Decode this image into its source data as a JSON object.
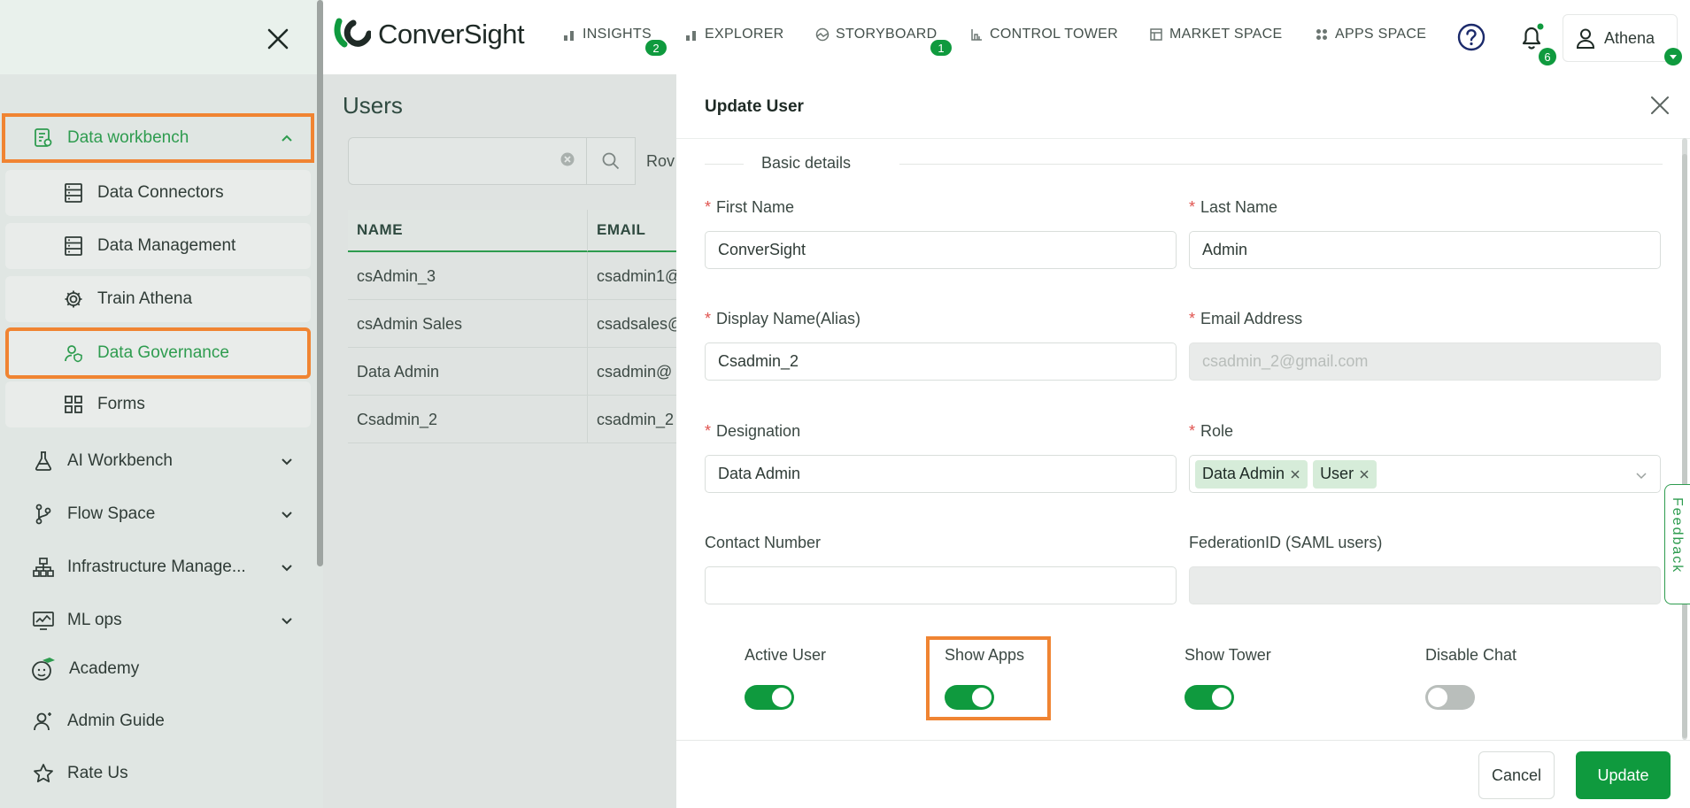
{
  "sidebar": {
    "items": [
      {
        "label": "Data workbench",
        "icon": "data-workbench-icon"
      },
      {
        "label": "Data Connectors",
        "icon": "database-icon"
      },
      {
        "label": "Data Management",
        "icon": "database-icon"
      },
      {
        "label": "Train Athena",
        "icon": "gear-icon"
      },
      {
        "label": "Data Governance",
        "icon": "user-shield-icon"
      },
      {
        "label": "Forms",
        "icon": "grid-icon"
      },
      {
        "label": "AI Workbench",
        "icon": "flask-icon"
      },
      {
        "label": "Flow Space",
        "icon": "branch-icon"
      },
      {
        "label": "Infrastructure Manage...",
        "icon": "hierarchy-icon"
      },
      {
        "label": "ML ops",
        "icon": "chart-monitor-icon"
      },
      {
        "label": "Academy",
        "icon": "academy-icon"
      },
      {
        "label": "Admin Guide",
        "icon": "admin-guide-icon"
      },
      {
        "label": "Rate Us",
        "icon": "star-icon"
      }
    ]
  },
  "header": {
    "logo_text": "ConverSight",
    "nav": [
      {
        "label": "INSIGHTS",
        "badge": "2"
      },
      {
        "label": "EXPLORER"
      },
      {
        "label": "STORYBOARD",
        "badge": "1"
      },
      {
        "label": "CONTROL TOWER"
      },
      {
        "label": "MARKET SPACE"
      },
      {
        "label": "APPS SPACE"
      }
    ],
    "notifications_badge": "6",
    "user_name": "Athena"
  },
  "users_page": {
    "title": "Users",
    "rows_label": "Rov",
    "columns": [
      "NAME",
      "EMAIL"
    ],
    "rows": [
      {
        "name": "csAdmin_3",
        "email": "csadmin1@"
      },
      {
        "name": "csAdmin Sales",
        "email": "csadsales@"
      },
      {
        "name": "Data Admin",
        "email": "csadmin@"
      },
      {
        "name": "Csadmin_2",
        "email": "csadmin_2"
      }
    ]
  },
  "modal": {
    "title": "Update User",
    "section": "Basic details",
    "fields": {
      "first_name": {
        "label": "First Name",
        "value": "ConverSight"
      },
      "last_name": {
        "label": "Last Name",
        "value": "Admin"
      },
      "display_name": {
        "label": "Display Name(Alias)",
        "value": "Csadmin_2"
      },
      "email": {
        "label": "Email Address",
        "value": "csadmin_2@gmail.com"
      },
      "designation": {
        "label": "Designation",
        "value": "Data Admin"
      },
      "role": {
        "label": "Role",
        "tags": [
          "Data Admin",
          "User"
        ]
      },
      "contact": {
        "label": "Contact Number",
        "value": ""
      },
      "federation": {
        "label": "FederationID (SAML users)",
        "value": ""
      }
    },
    "toggles": [
      {
        "label": "Active User",
        "on": true
      },
      {
        "label": "Show Apps",
        "on": true
      },
      {
        "label": "Show Tower",
        "on": true
      },
      {
        "label": "Disable Chat",
        "on": false
      }
    ],
    "cancel_label": "Cancel",
    "update_label": "Update"
  },
  "feedback_label": "Feedback",
  "colors": {
    "accent": "#0f9a3e",
    "highlight": "#f08432"
  }
}
